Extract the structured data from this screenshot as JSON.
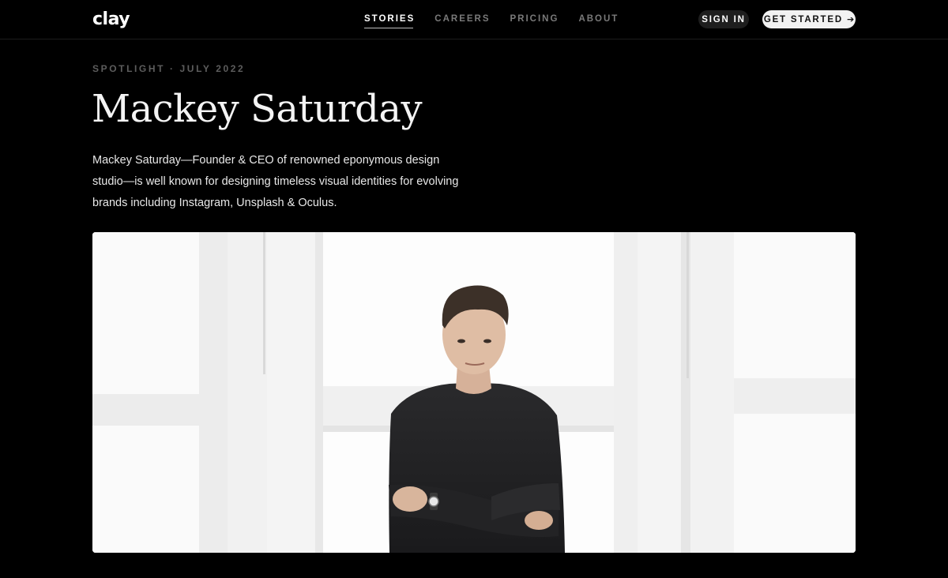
{
  "header": {
    "logo_text": "clay",
    "nav": [
      {
        "label": "STORIES",
        "active": true
      },
      {
        "label": "CAREERS",
        "active": false
      },
      {
        "label": "PRICING",
        "active": false
      },
      {
        "label": "ABOUT",
        "active": false
      }
    ],
    "sign_in_label": "SIGN IN",
    "get_started_label": "GET STARTED",
    "get_started_icon": "arrow-right-icon"
  },
  "article": {
    "eyebrow": "SPOTLIGHT · JULY 2022",
    "title": "Mackey Saturday",
    "lede": "Mackey Saturday—Founder & CEO of renowned eponymous design studio—is well known for designing timeless visual identities for evolving brands including Instagram, Unsplash & Oculus."
  },
  "colors": {
    "background": "#000000",
    "button_primary_bg": "#f2f2f2",
    "button_secondary_bg": "#1e1e1e",
    "nav_inactive": "#7a7a7a"
  }
}
